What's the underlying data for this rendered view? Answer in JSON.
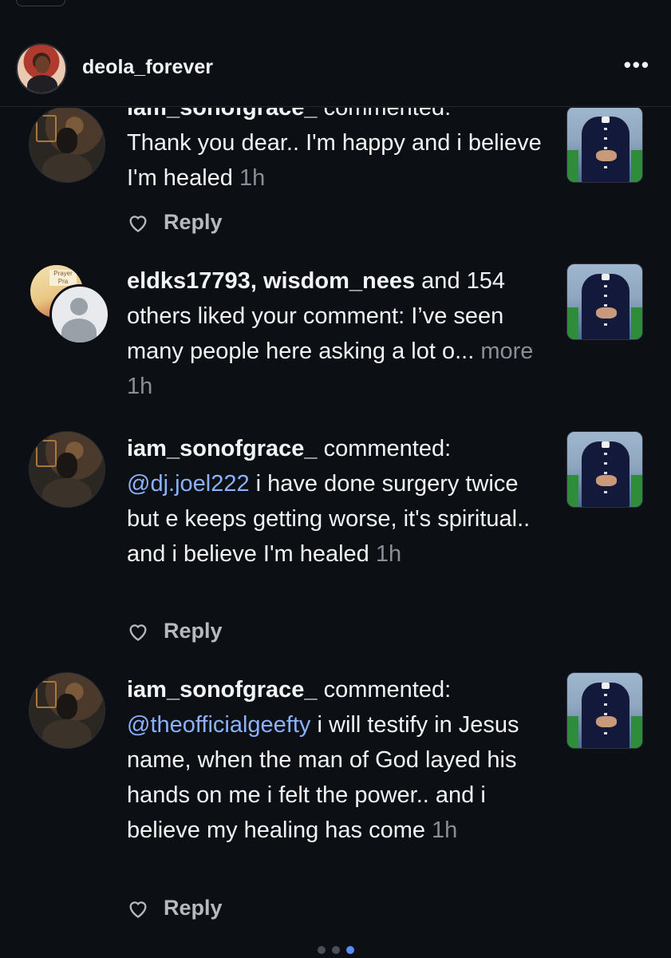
{
  "header": {
    "username": "deola_forever",
    "more_icon": "more-horizontal-icon",
    "more_label": "•••"
  },
  "notifications": [
    {
      "type": "comment",
      "username": "iam_sonofgrace_",
      "action": " commented:",
      "mention": "",
      "text": "Thank you dear.. I'm happy and i believe I'm healed",
      "time": "1h",
      "reply_label": "Reply"
    },
    {
      "type": "like",
      "user1": "eldks17793",
      "sep": ", ",
      "user2": "wisdom_nees",
      "action": " and 154 others liked your comment: I’ve seen many people here asking a lot o...",
      "more_label": " more",
      "time": "1h",
      "poster_text": "Prayer Pra"
    },
    {
      "type": "comment",
      "username": "iam_sonofgrace_",
      "action": " commented:",
      "mention": "@dj.joel222",
      "text": " i have done surgery twice but e keeps getting worse, it's spiritual.. and i believe I'm healed",
      "time": "1h",
      "reply_label": "Reply"
    },
    {
      "type": "comment",
      "username": "iam_sonofgrace_",
      "action": " commented:",
      "mention": "@theofficialgeefty",
      "text": " i will testify in Jesus name, when the man of God layed his hands on me i felt the power.. and i believe my healing has come",
      "time": "1h",
      "reply_label": "Reply"
    }
  ],
  "pagination": {
    "pages": 3,
    "active_page": 3
  },
  "colors": {
    "background": "#0c0f14",
    "mention": "#8ab2ff",
    "muted": "#8a8e96",
    "active_dot": "#5b8cff"
  }
}
